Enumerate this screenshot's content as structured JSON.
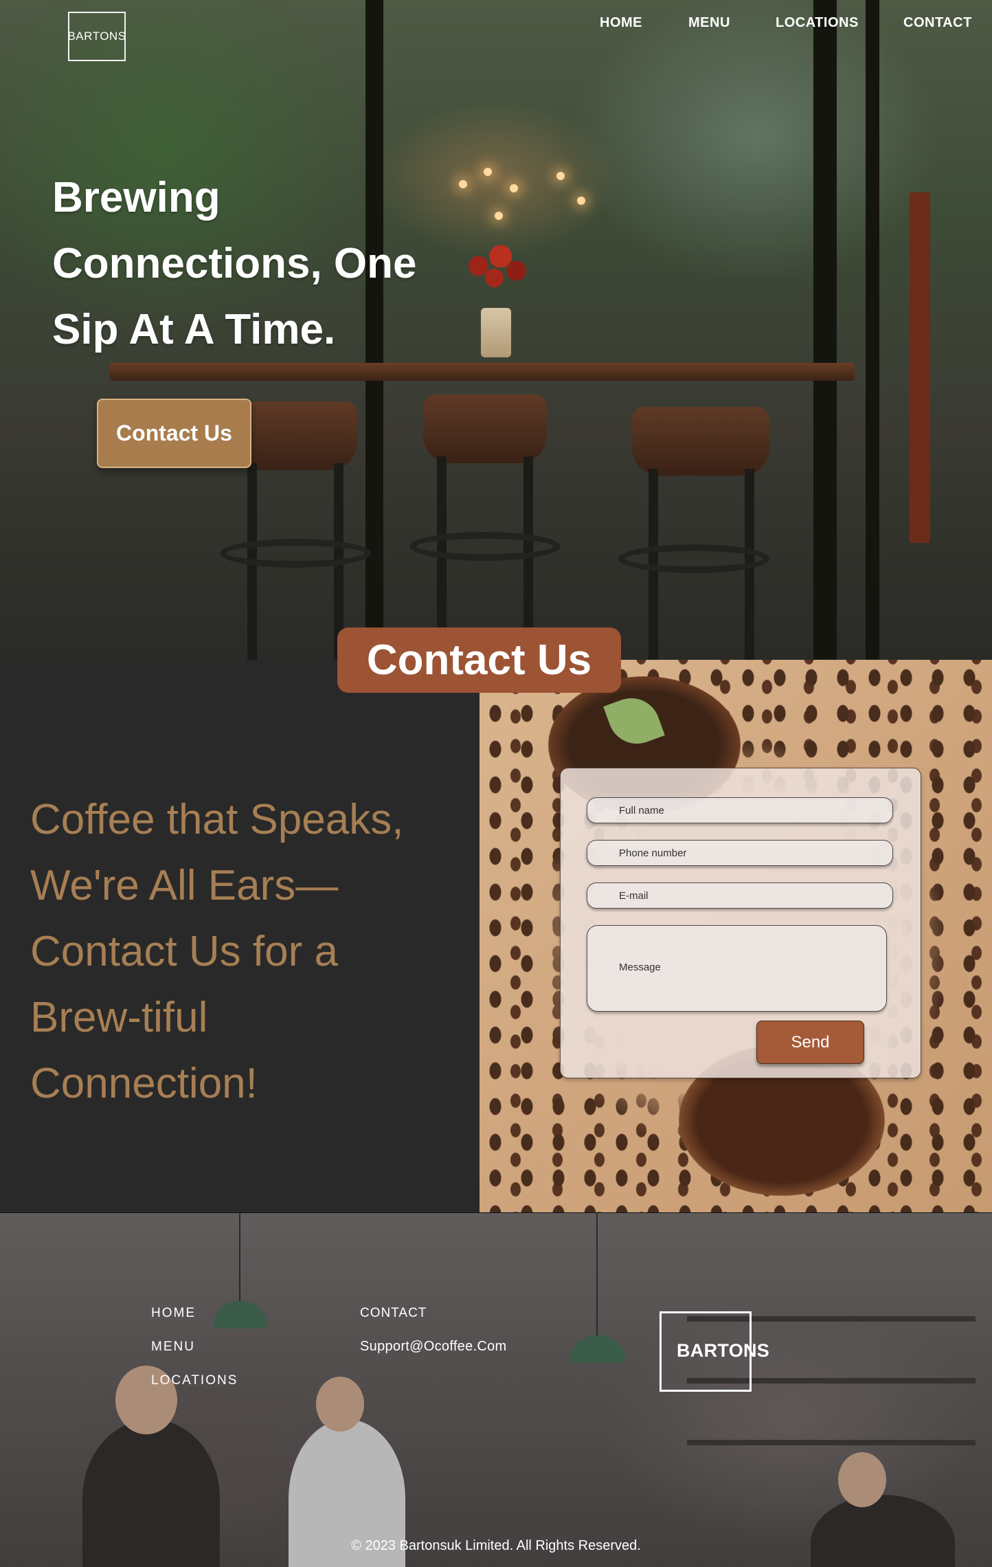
{
  "brand": {
    "name": "BARTONS"
  },
  "nav": {
    "home": "HOME",
    "menu": "MENU",
    "locations": "LOCATIONS",
    "contact": "CONTACT"
  },
  "hero": {
    "title_lines": [
      "Brewing",
      "Connections, One",
      "Sip At A Time."
    ],
    "cta_label": "Contact Us"
  },
  "contact": {
    "section_title": "Contact Us",
    "tagline_lines": [
      "Coffee that Speaks,",
      "We're All Ears—",
      "Contact Us for a",
      "Brew-tiful",
      "Connection!"
    ],
    "form": {
      "full_name_placeholder": "Full name",
      "phone_placeholder": "Phone number",
      "email_placeholder": "E-mail",
      "message_placeholder": "Message",
      "send_label": "Send"
    }
  },
  "footer": {
    "links": {
      "home": "HOME",
      "menu": "MENU",
      "locations": "LOCATIONS"
    },
    "contact_label": "CONTACT",
    "email": "Support@Ocoffee.Com",
    "logo_text": "BARTONS",
    "copyright": "© 2023 Bartonsuk Limited. All Rights Reserved."
  },
  "colors": {
    "accent_brown": "#9c5434",
    "cta_tan": "#a87c4d",
    "tagline_gold": "#a77f54",
    "dark_panel": "#292929"
  }
}
